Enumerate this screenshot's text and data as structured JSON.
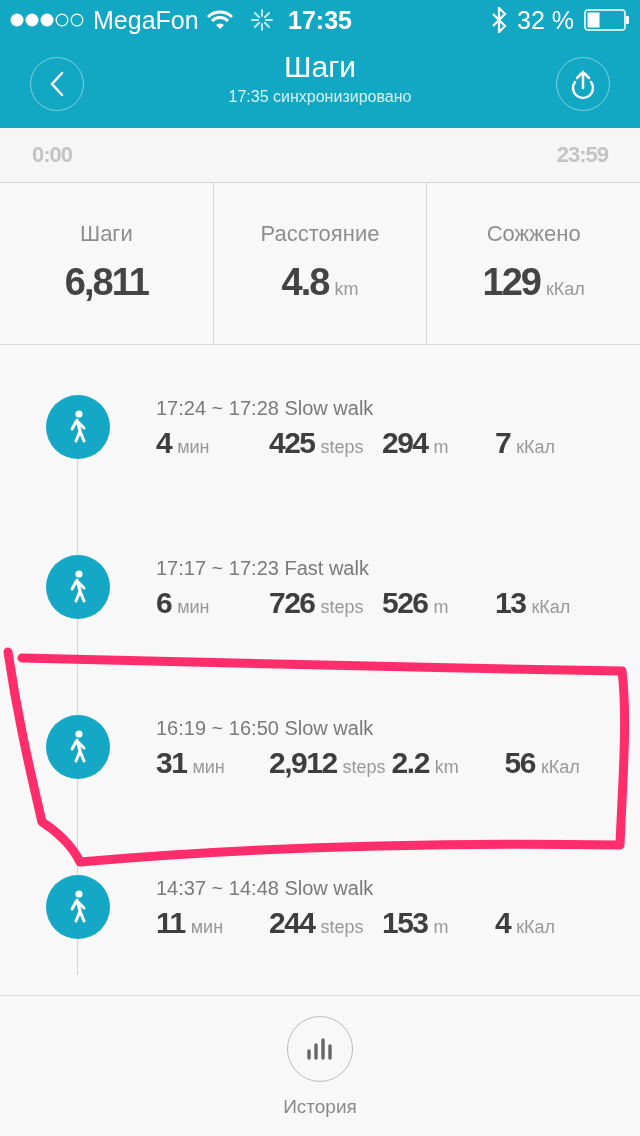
{
  "status_bar": {
    "carrier": "MegaFon",
    "time": "17:35",
    "battery": "32 %"
  },
  "header": {
    "title": "Шаги",
    "subtitle": "17:35 синхронизировано"
  },
  "range": {
    "start": "0:00",
    "end": "23:59"
  },
  "stats": [
    {
      "label": "Шаги",
      "value": "6,811"
    },
    {
      "label": "Расстояние",
      "value": "4.8",
      "unit": "km"
    },
    {
      "label": "Сожжено",
      "value": "129",
      "unit": "кКал"
    }
  ],
  "activities": [
    {
      "title": "17:24 ~ 17:28 Slow walk",
      "metrics": [
        {
          "value": "4",
          "unit": "мин"
        },
        {
          "value": "425",
          "unit": "steps"
        },
        {
          "value": "294",
          "unit": "m"
        },
        {
          "value": "7",
          "unit": "кКал"
        }
      ]
    },
    {
      "title": "17:17 ~ 17:23 Fast walk",
      "metrics": [
        {
          "value": "6",
          "unit": "мин"
        },
        {
          "value": "726",
          "unit": "steps"
        },
        {
          "value": "526",
          "unit": "m"
        },
        {
          "value": "13",
          "unit": "кКал"
        }
      ]
    },
    {
      "title": "16:19 ~ 16:50 Slow walk",
      "metrics": [
        {
          "value": "31",
          "unit": "мин"
        },
        {
          "value": "2,912",
          "unit": "steps"
        },
        {
          "value": "2.2",
          "unit": "km"
        },
        {
          "value": "56",
          "unit": "кКал"
        }
      ]
    },
    {
      "title": "14:37 ~ 14:48 Slow walk",
      "metrics": [
        {
          "value": "11",
          "unit": "мин"
        },
        {
          "value": "244",
          "unit": "steps"
        },
        {
          "value": "153",
          "unit": "m"
        },
        {
          "value": "4",
          "unit": "кКал"
        }
      ]
    }
  ],
  "footer": {
    "label": "История"
  },
  "annotations": [
    {
      "kind": "frame"
    }
  ]
}
